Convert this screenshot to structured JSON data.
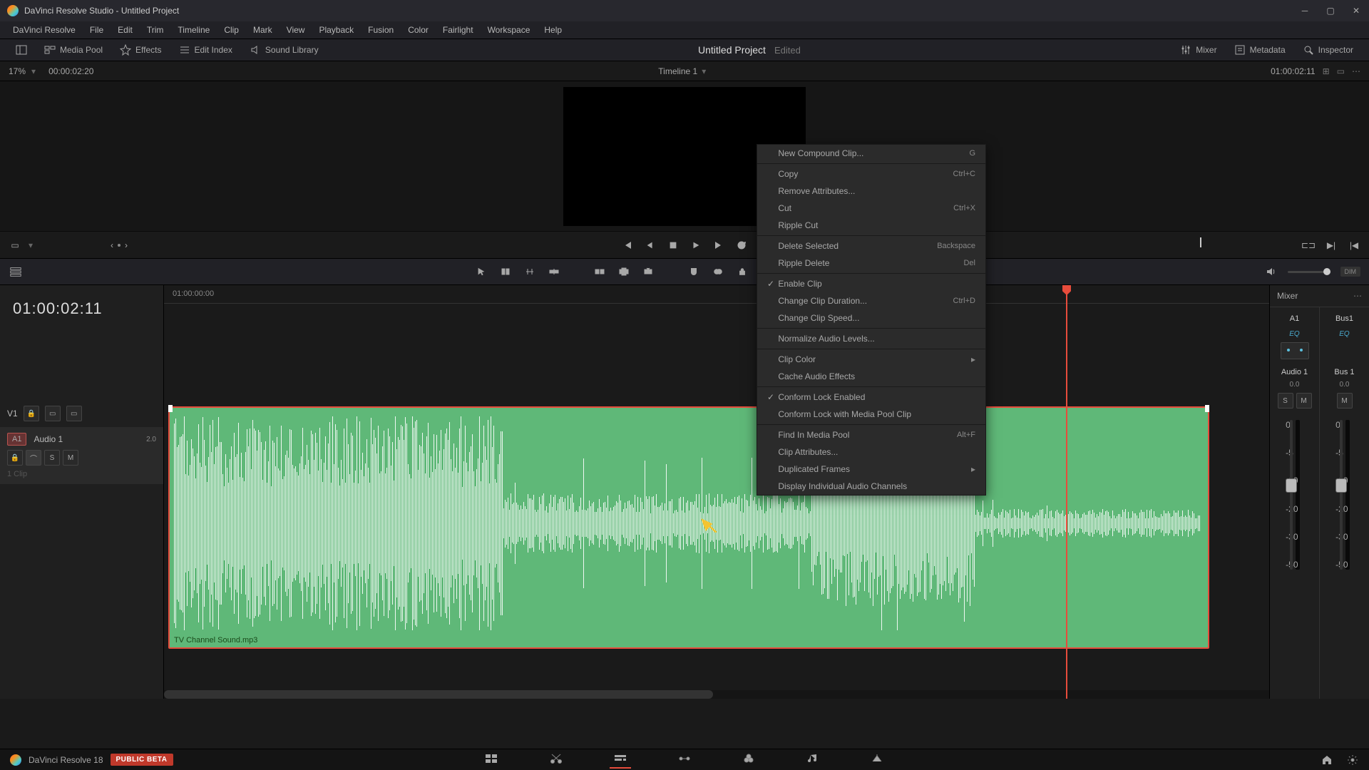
{
  "titlebar": {
    "title": "DaVinci Resolve Studio - Untitled Project"
  },
  "menubar": [
    "DaVinci Resolve",
    "File",
    "Edit",
    "Trim",
    "Timeline",
    "Clip",
    "Mark",
    "View",
    "Playback",
    "Fusion",
    "Color",
    "Fairlight",
    "Workspace",
    "Help"
  ],
  "toolbar": {
    "media_pool": "Media Pool",
    "effects": "Effects",
    "edit_index": "Edit Index",
    "sound_library": "Sound Library",
    "project": "Untitled Project",
    "edited": "Edited",
    "mixer": "Mixer",
    "metadata": "Metadata",
    "inspector": "Inspector"
  },
  "subheader": {
    "zoom": "17%",
    "tc_left": "00:00:02:20",
    "timeline_name": "Timeline 1",
    "tc_right": "01:00:02:11"
  },
  "timeline": {
    "big_tc": "01:00:02:11",
    "ruler_start": "01:00:00:00",
    "v1": "V1",
    "a1_badge": "A1",
    "a1_name": "Audio 1",
    "a1_val": "2.0",
    "clip_count": "1 Clip",
    "clip_name": "TV Channel Sound.mp3"
  },
  "mixer": {
    "title": "Mixer",
    "ch1": "A1",
    "ch2": "Bus1",
    "eq": "EQ",
    "track1": "Audio 1",
    "track2": "Bus 1",
    "db": "0.0",
    "scale": [
      "0",
      "-5",
      "-10",
      "-20",
      "-30",
      "-50"
    ]
  },
  "context": [
    {
      "label": "New Compound Clip...",
      "sc": "G"
    },
    {
      "sep": true
    },
    {
      "label": "Copy",
      "sc": "Ctrl+C"
    },
    {
      "label": "Remove Attributes..."
    },
    {
      "label": "Cut",
      "sc": "Ctrl+X"
    },
    {
      "label": "Ripple Cut"
    },
    {
      "sep": true
    },
    {
      "label": "Delete Selected",
      "sc": "Backspace"
    },
    {
      "label": "Ripple Delete",
      "sc": "Del"
    },
    {
      "sep": true
    },
    {
      "label": "Enable Clip",
      "check": true
    },
    {
      "label": "Change Clip Duration...",
      "sc": "Ctrl+D"
    },
    {
      "label": "Change Clip Speed..."
    },
    {
      "sep": true
    },
    {
      "label": "Normalize Audio Levels..."
    },
    {
      "sep": true
    },
    {
      "label": "Clip Color",
      "sub": true
    },
    {
      "label": "Cache Audio Effects"
    },
    {
      "sep": true
    },
    {
      "label": "Conform Lock Enabled",
      "check": true
    },
    {
      "label": "Conform Lock with Media Pool Clip"
    },
    {
      "sep": true
    },
    {
      "label": "Find In Media Pool",
      "sc": "Alt+F"
    },
    {
      "label": "Clip Attributes..."
    },
    {
      "label": "Duplicated Frames",
      "sub": true
    },
    {
      "label": "Display Individual Audio Channels"
    }
  ],
  "bottom": {
    "app": "DaVinci Resolve 18",
    "beta": "PUBLIC BETA"
  }
}
